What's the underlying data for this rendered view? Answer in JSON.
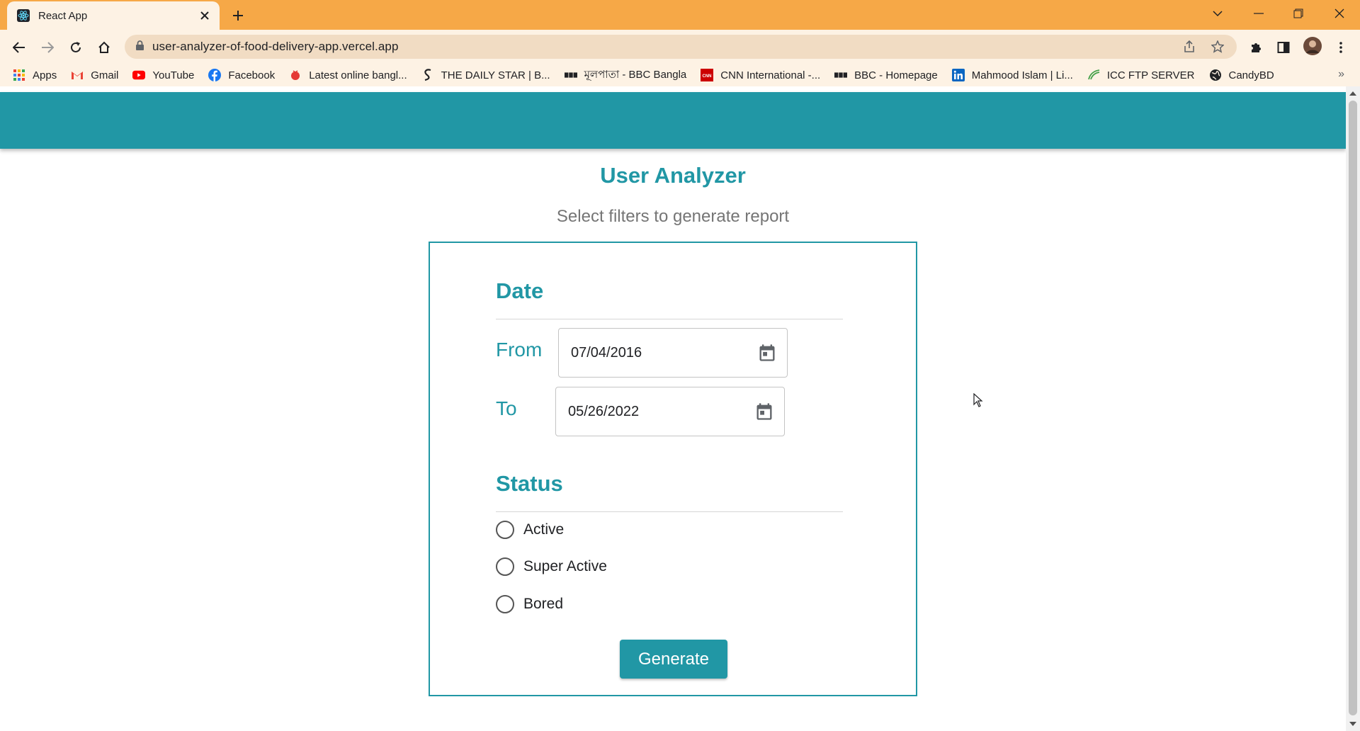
{
  "browser": {
    "tab_title": "React App",
    "url": "user-analyzer-of-food-delivery-app.vercel.app",
    "bookmarks": [
      {
        "label": "Apps",
        "icon": "apps-grid-icon"
      },
      {
        "label": "Gmail",
        "icon": "gmail-icon"
      },
      {
        "label": "YouTube",
        "icon": "youtube-icon"
      },
      {
        "label": "Facebook",
        "icon": "facebook-icon"
      },
      {
        "label": "Latest online bangl...",
        "icon": "news-icon"
      },
      {
        "label": "THE DAILY STAR | B...",
        "icon": "daily-star-icon"
      },
      {
        "label": "মূলপাতা - BBC Bangla",
        "icon": "bbc-icon"
      },
      {
        "label": "CNN International -...",
        "icon": "cnn-icon"
      },
      {
        "label": "BBC - Homepage",
        "icon": "bbc-icon"
      },
      {
        "label": "Mahmood Islam | Li...",
        "icon": "linkedin-icon"
      },
      {
        "label": "ICC FTP SERVER",
        "icon": "icc-icon"
      },
      {
        "label": "CandyBD",
        "icon": "globe-icon"
      }
    ],
    "overflow_label": "»"
  },
  "page": {
    "title": "User Analyzer",
    "subtitle": "Select filters to generate report",
    "date_section": {
      "title": "Date",
      "from_label": "From",
      "from_value": "07/04/2016",
      "to_label": "To",
      "to_value": "05/26/2022"
    },
    "status_section": {
      "title": "Status",
      "options": [
        "Active",
        "Super Active",
        "Bored"
      ]
    },
    "generate_label": "Generate"
  },
  "colors": {
    "accent": "#2197a5",
    "tab_strip": "#f6a847",
    "toolbar": "#fdf2e4"
  }
}
